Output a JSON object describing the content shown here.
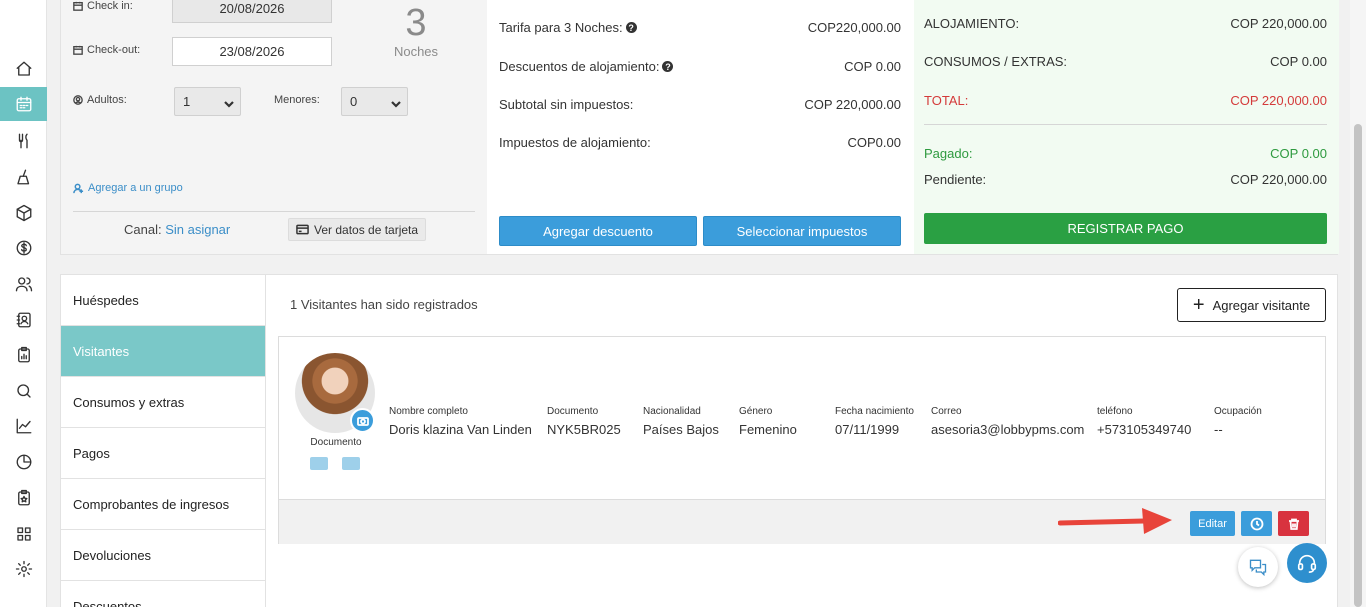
{
  "sidebar": {
    "icons": [
      "home-icon",
      "calendar-icon",
      "utensils-icon",
      "broom-icon",
      "box-icon",
      "dollar-icon",
      "users-icon",
      "contacts-icon",
      "clipboard-icon",
      "search-icon",
      "chart-line-icon",
      "pie-chart-icon",
      "clipboard-star-icon",
      "apps-icon",
      "gear-icon"
    ],
    "active": "calendar-icon"
  },
  "stay": {
    "checkin_label": "Check in:",
    "checkin_value": "20/08/2026",
    "checkout_label": "Check-out:",
    "checkout_value": "23/08/2026",
    "nights_count": "3",
    "nights_label": "Noches",
    "adults_label": "Adultos:",
    "adults_value": "1",
    "minors_label": "Menores:",
    "minors_value": "0",
    "group_link": "Agregar a un grupo",
    "channel_label": "Canal:",
    "channel_value": "Sin asignar",
    "card_button": "Ver datos de tarjeta"
  },
  "rates": {
    "rows": [
      {
        "label": "Tarifa para 3 Noches:",
        "value": "COP220,000.00"
      },
      {
        "label": "Descuentos de alojamiento:",
        "value": "COP 0.00"
      },
      {
        "label": "Subtotal sin impuestos:",
        "value": "COP 220,000.00"
      },
      {
        "label": "Impuestos de alojamiento:",
        "value": "COP0.00"
      }
    ],
    "discount_button": "Agregar descuento",
    "taxes_button": "Seleccionar impuestos"
  },
  "summary": {
    "lodging_label": "ALOJAMIENTO:",
    "lodging_value": "COP 220,000.00",
    "extras_label": "CONSUMOS / EXTRAS:",
    "extras_value": "COP 0.00",
    "total_label": "TOTAL:",
    "total_value": "COP 220,000.00",
    "paid_label": "Pagado:",
    "paid_value": "COP 0.00",
    "pending_label": "Pendiente:",
    "pending_value": "COP 220,000.00",
    "register_button": "REGISTRAR PAGO"
  },
  "tabs": [
    "Huéspedes",
    "Visitantes",
    "Consumos y extras",
    "Pagos",
    "Comprobantes de ingresos",
    "Devoluciones",
    "Descuentos"
  ],
  "active_tab": "Visitantes",
  "visitors": {
    "count_text": "1 Visitantes han sido registrados",
    "add_button": "Agregar visitante",
    "document_label": "Documento",
    "fields": [
      {
        "label": "Nombre completo",
        "value": "Doris klazina Van Linden"
      },
      {
        "label": "Documento",
        "value": "NYK5BR025"
      },
      {
        "label": "Nacionalidad",
        "value": "Países Bajos"
      },
      {
        "label": "Género",
        "value": "Femenino"
      },
      {
        "label": "Fecha nacimiento",
        "value": "07/11/1999"
      },
      {
        "label": "Correo",
        "value": "asesoria3@lobbypms.com"
      },
      {
        "label": "teléfono",
        "value": "+573105349740"
      },
      {
        "label": "Ocupación",
        "value": "--"
      }
    ],
    "edit_button": "Editar"
  },
  "colors": {
    "accent_teal": "#6cc3c3",
    "primary_blue": "#3b9ddb",
    "success_green": "#2aa043",
    "danger_red": "#d8333f"
  }
}
